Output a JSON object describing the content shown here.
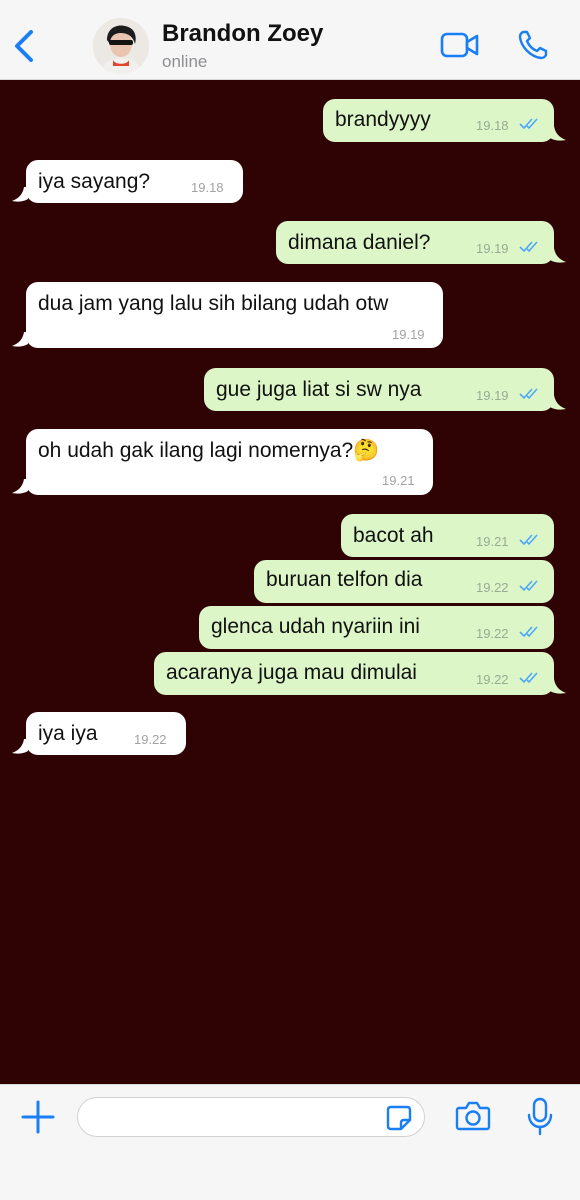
{
  "header": {
    "contact_name": "Brandon Zoey",
    "status": "online",
    "icons": {
      "back": "chevron-left-icon",
      "video": "video-camera-icon",
      "call": "phone-icon"
    }
  },
  "messages": [
    {
      "direction": "outgoing",
      "text": "brandyyyy",
      "time": "19.18",
      "read": true
    },
    {
      "direction": "incoming",
      "text": "iya sayang?",
      "time": "19.18"
    },
    {
      "direction": "outgoing",
      "text": "dimana daniel?",
      "time": "19.19",
      "read": true
    },
    {
      "direction": "incoming",
      "text": "dua jam yang lalu sih bilang udah otw",
      "time": "19.19"
    },
    {
      "direction": "outgoing",
      "text": "gue juga liat si sw nya",
      "time": "19.19",
      "read": true
    },
    {
      "direction": "incoming",
      "text": "oh udah gak ilang lagi nomernya?🤔",
      "time": "19.21"
    },
    {
      "direction": "outgoing",
      "text": "bacot ah",
      "time": "19.21",
      "read": true
    },
    {
      "direction": "outgoing",
      "text": "buruan telfon dia",
      "time": "19.22",
      "read": true
    },
    {
      "direction": "outgoing",
      "text": "glenca udah nyariin ini",
      "time": "19.22",
      "read": true
    },
    {
      "direction": "outgoing",
      "text": "acaranya juga mau dimulai",
      "time": "19.22",
      "read": true
    },
    {
      "direction": "incoming",
      "text": "iya iya",
      "time": "19.22"
    }
  ],
  "composer": {
    "value": "",
    "icons": {
      "add": "plus-icon",
      "sticker": "sticker-icon",
      "camera": "camera-icon",
      "mic": "microphone-icon"
    }
  },
  "colors": {
    "accent": "#1a7ff5",
    "chat_background": "#2f0203",
    "outgoing_bubble": "#dcf6c8",
    "incoming_bubble": "#ffffff",
    "read_ticks": "#4fa8f6"
  }
}
